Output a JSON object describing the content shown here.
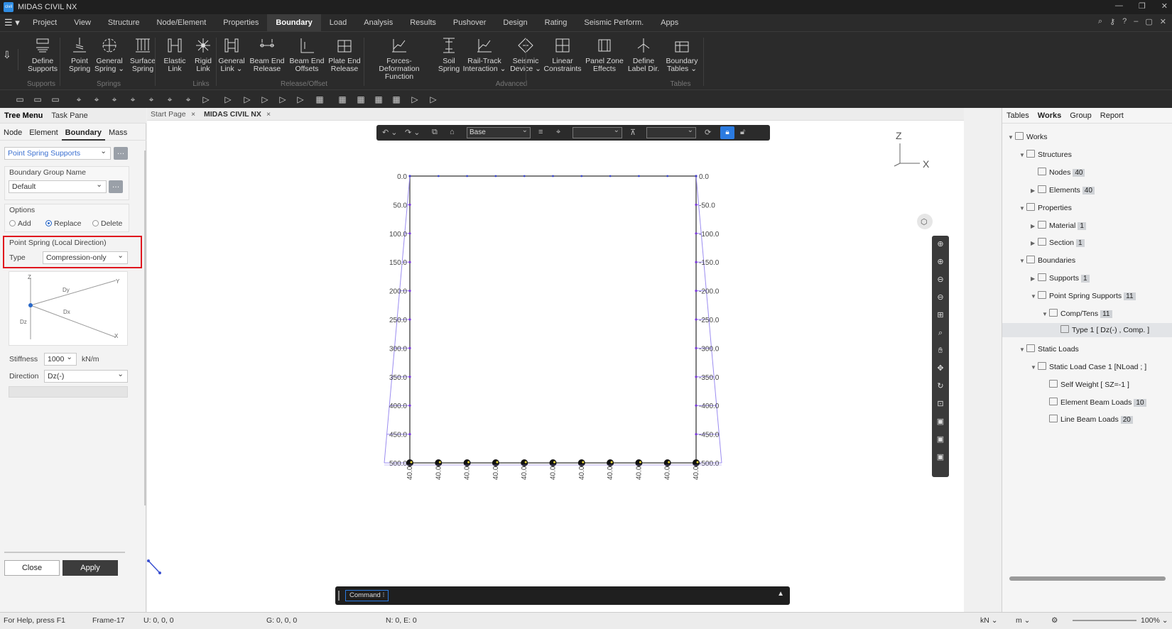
{
  "app": {
    "title": "MIDAS CIVIL NX",
    "logo": "civil"
  },
  "menu": [
    "Project",
    "View",
    "Structure",
    "Node/Element",
    "Properties",
    "Boundary",
    "Load",
    "Analysis",
    "Results",
    "Pushover",
    "Design",
    "Rating",
    "Seismic Perform.",
    "Apps"
  ],
  "menu_active": "Boundary",
  "ribbon": {
    "buttons": [
      {
        "l1": "Define",
        "l2": "Supports",
        "icon": "support-icon"
      },
      {
        "l1": "Point",
        "l2": "Spring",
        "icon": "point-spring-icon"
      },
      {
        "l1": "General",
        "l2": "Spring ⌄",
        "icon": "general-spring-icon"
      },
      {
        "l1": "Surface",
        "l2": "Spring",
        "icon": "surface-spring-icon"
      },
      {
        "l1": "Elastic",
        "l2": "Link",
        "icon": "elastic-link-icon"
      },
      {
        "l1": "Rigid",
        "l2": "Link",
        "icon": "rigid-link-icon"
      },
      {
        "l1": "General",
        "l2": "Link ⌄",
        "icon": "general-link-icon"
      },
      {
        "l1": "Beam End",
        "l2": "Release",
        "icon": "beam-end-release-icon"
      },
      {
        "l1": "Beam End",
        "l2": "Offsets",
        "icon": "beam-end-offsets-icon"
      },
      {
        "l1": "Plate End",
        "l2": "Release",
        "icon": "plate-end-release-icon"
      },
      {
        "l1": "Forces-Deformation",
        "l2": "Function",
        "icon": "forces-deformation-icon"
      },
      {
        "l1": "Soil",
        "l2": "Spring",
        "icon": "soil-spring-icon"
      },
      {
        "l1": "Rail-Track",
        "l2": "Interaction ⌄",
        "icon": "rail-track-icon"
      },
      {
        "l1": "Seismic",
        "l2": "Device ⌄",
        "icon": "seismic-device-icon"
      },
      {
        "l1": "Linear",
        "l2": "Constraints",
        "icon": "linear-constraints-icon"
      },
      {
        "l1": "Panel Zone",
        "l2": "Effects",
        "icon": "panel-zone-icon"
      },
      {
        "l1": "Define",
        "l2": "Label Dir.",
        "icon": "label-dir-icon"
      },
      {
        "l1": "Boundary",
        "l2": "Tables ⌄",
        "icon": "boundary-tables-icon"
      }
    ],
    "groups": [
      "Supports",
      "Springs",
      "Links",
      "Release/Offset",
      "Advanced",
      "Tables"
    ]
  },
  "left": {
    "tabs": [
      "Tree Menu",
      "Task Pane"
    ],
    "subtabs": [
      "Node",
      "Element",
      "Boundary",
      "Mass"
    ],
    "mode_select": "Point Spring Supports",
    "group_label": "Boundary Group Name",
    "group_value": "Default",
    "options_label": "Options",
    "options": [
      "Add",
      "Replace",
      "Delete"
    ],
    "selected_option": "Replace",
    "ps_title": "Point Spring (Local Direction)",
    "type_label": "Type",
    "type_value": "Compression-only",
    "diagram": {
      "z": "Z",
      "y": "Y",
      "x": "X",
      "dy": "Dy",
      "dx": "Dx",
      "dz": "Dz"
    },
    "stiffness_label": "Stiffness",
    "stiffness_value": "1000",
    "stiffness_unit": "kN/m",
    "direction_label": "Direction",
    "direction_value": "Dz(-)",
    "close": "Close",
    "apply": "Apply"
  },
  "doc_tabs": [
    "Start Page",
    "MIDAS CIVIL NX"
  ],
  "view": {
    "base_select": "Base",
    "axes": {
      "z": "Z",
      "x": "X"
    },
    "left_labels": [
      "0.0",
      "50.0",
      "100.0",
      "150.0",
      "200.0",
      "250.0",
      "300.0",
      "350.0",
      "400.0",
      "450.0",
      "500.0"
    ],
    "right_labels": [
      "0.0",
      "-50.0",
      "-100.0",
      "-150.0",
      "-200.0",
      "-250.0",
      "-300.0",
      "-350.0",
      "-400.0",
      "-450.0",
      "-500.0"
    ],
    "bottom_label": "40.0",
    "command": "Command ⁝"
  },
  "right": {
    "tabs": [
      "Tables",
      "Works",
      "Group",
      "Report"
    ],
    "tree": [
      {
        "t": "Works",
        "lvl": 0,
        "arrow": "▼"
      },
      {
        "t": "Structures",
        "lvl": 1,
        "arrow": "▼"
      },
      {
        "t": "Nodes",
        "lvl": 2,
        "arrow": "",
        "c": "40"
      },
      {
        "t": "Elements",
        "lvl": 2,
        "arrow": "▶",
        "c": "40"
      },
      {
        "t": "Properties",
        "lvl": 1,
        "arrow": "▼"
      },
      {
        "t": "Material",
        "lvl": 2,
        "arrow": "▶",
        "c": "1"
      },
      {
        "t": "Section",
        "lvl": 2,
        "arrow": "▶",
        "c": "1"
      },
      {
        "t": "Boundaries",
        "lvl": 1,
        "arrow": "▼"
      },
      {
        "t": "Supports",
        "lvl": 2,
        "arrow": "▶",
        "c": "1"
      },
      {
        "t": "Point Spring Supports",
        "lvl": 2,
        "arrow": "▼",
        "c": "11"
      },
      {
        "t": "Comp/Tens",
        "lvl": 3,
        "arrow": "▼",
        "c": "11"
      },
      {
        "t": "Type 1 [ Dz(-) , Comp. ]",
        "lvl": 4,
        "arrow": ""
      },
      {
        "t": "Static Loads",
        "lvl": 1,
        "arrow": "▼"
      },
      {
        "t": "Static Load Case 1 [NLoad ; ]",
        "lvl": 2,
        "arrow": "▼"
      },
      {
        "t": "Self Weight [ SZ=-1 ]",
        "lvl": 3,
        "arrow": ""
      },
      {
        "t": "Element Beam Loads",
        "lvl": 3,
        "arrow": "",
        "c": "10"
      },
      {
        "t": "Line Beam Loads",
        "lvl": 3,
        "arrow": "",
        "c": "20"
      }
    ]
  },
  "status": {
    "help": "For Help, press F1",
    "frame": "Frame-17",
    "u": "U: 0, 0, 0",
    "g": "G: 0, 0, 0",
    "ne": "N: 0, E: 0",
    "force": "kN ⌄",
    "length": "m ⌄",
    "zoom": "100% ⌄"
  }
}
